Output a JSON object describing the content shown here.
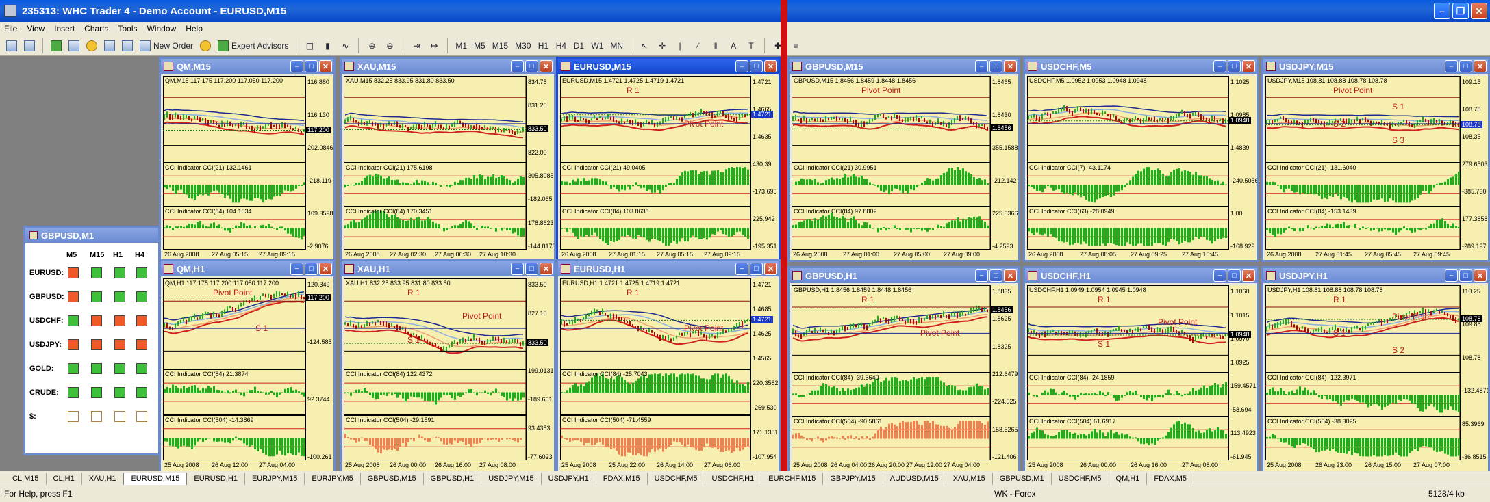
{
  "window": {
    "title": "235313: WHC Trader 4 - Demo Account - EURUSD,M15"
  },
  "menu": [
    "File",
    "View",
    "Insert",
    "Charts",
    "Tools",
    "Window",
    "Help"
  ],
  "toolbar": {
    "new_order": "New Order",
    "expert_advisors": "Expert Advisors",
    "periods": [
      "M1",
      "M5",
      "M15",
      "M30",
      "H1",
      "H4",
      "D1",
      "W1",
      "MN"
    ]
  },
  "panel": {
    "title": "GBPUSD,M1",
    "headers": [
      "M5",
      "M15",
      "H1",
      "H4"
    ],
    "rows": [
      {
        "label": "EURUSD:",
        "cells": [
          "r",
          "g",
          "g",
          "g"
        ]
      },
      {
        "label": "GBPUSD:",
        "cells": [
          "r",
          "g",
          "g",
          "g"
        ]
      },
      {
        "label": "USDCHF:",
        "cells": [
          "g",
          "r",
          "r",
          "r"
        ]
      },
      {
        "label": "USDJPY:",
        "cells": [
          "r",
          "r",
          "r",
          "r"
        ]
      },
      {
        "label": "GOLD:",
        "cells": [
          "g",
          "g",
          "g",
          "g"
        ]
      },
      {
        "label": "CRUDE:",
        "cells": [
          "g",
          "g",
          "g",
          "g"
        ]
      },
      {
        "label": "$:",
        "cells": [
          "w",
          "w",
          "w",
          "w"
        ]
      }
    ]
  },
  "charts": [
    {
      "title": "QM,M15",
      "header": "QM,M15  117.175 117.200 117.050 117.200",
      "ind1": "CCI Indicator  CCI(21) 132.1461",
      "ind2": "CCI Indicator  CCI(84) 104.1534",
      "prices": [
        "116.880",
        "116.130",
        "202.0846",
        "-218.119",
        "109.3598",
        "-2.9076"
      ],
      "price_tag": "117.200",
      "xlabels": [
        "26 Aug 2008",
        "27 Aug 05:15",
        "27 Aug 09:15"
      ],
      "annot": []
    },
    {
      "title": "XAU,M15",
      "header": "XAU,M15  832.25 833.95 831.80 833.50",
      "ind1": "CCI Indicator  CCI(21) 175.6198",
      "ind2": "CCI Indicator  CCI(84) 170.3451",
      "prices": [
        "834.75",
        "831.20",
        "828.15",
        "822.00",
        "305.8085",
        "-182.065",
        "178.8623",
        "-144.8173"
      ],
      "price_tag": "833.50",
      "xlabels": [
        "26 Aug 2008",
        "27 Aug 02:30",
        "27 Aug 06:30",
        "27 Aug 10:30"
      ],
      "annot": []
    },
    {
      "title": "EURUSD,M15",
      "header": "EURUSD,M15  1.4721 1.4725 1.4719 1.4721",
      "ind1": "CCI Indicator  CCI(21) 49.0405",
      "ind2": "CCI Indicator  CCI(84) 103.8638",
      "prices": [
        "1.4721",
        "1.4665",
        "1.4635",
        "430.39",
        "-173.695",
        "225.942",
        "-195.351"
      ],
      "price_tag": "1.4721",
      "xlabels": [
        "26 Aug 2008",
        "27 Aug 01:15",
        "27 Aug 05:15",
        "27 Aug 09:15"
      ],
      "annot": [
        "R 1",
        "Pivot Point"
      ]
    },
    {
      "title": "GBPUSD,M15",
      "header": "GBPUSD,M15  1.8456 1.8459 1.8448 1.8456",
      "ind1": "CCI Indicator  CCI(21) 30.9951",
      "ind2": "CCI Indicator  CCI(84) 97.8802",
      "prices": [
        "1.8465",
        "1.8430",
        "355.1588",
        "-212.142",
        "225.5366",
        "-4.2593"
      ],
      "price_tag": "1.8456",
      "xlabels": [
        "26 Aug 2008",
        "27 Aug 01:00",
        "27 Aug 05:00",
        "27 Aug 09:00"
      ],
      "annot": [
        "Pivot Point"
      ]
    },
    {
      "title": "USDCHF,M5",
      "header": "USDCHF,M5  1.0952 1.0953 1.0948 1.0948",
      "ind1": "CCI Indicator  CCI(7) -43.1174",
      "ind2": "CCI Indicator  CCI(63) -28.0949",
      "prices": [
        "1.1025",
        "1.0985",
        "1.4839",
        "-240.5056",
        "1.00",
        "-168.929"
      ],
      "price_tag": "1.0948",
      "xlabels": [
        "26 Aug 2008",
        "27 Aug 08:05",
        "27 Aug 09:25",
        "27 Aug 10:45"
      ],
      "annot": []
    },
    {
      "title": "USDJPY,M15",
      "header": "USDJPY,M15  108.81 108.88 108.78 108.78",
      "ind1": "CCI Indicator  CCI(21) -131.6040",
      "ind2": "CCI Indicator  CCI(84) -153.1439",
      "prices": [
        "109.15",
        "108.78",
        "108.35",
        "279.6503",
        "-385.730",
        "177.3858",
        "-289.197"
      ],
      "price_tag": "108.78",
      "xlabels": [
        "26 Aug 2008",
        "27 Aug 01:45",
        "27 Aug 05:45",
        "27 Aug 09:45"
      ],
      "annot": [
        "Pivot Point",
        "S 1",
        "S 2",
        "S 3"
      ]
    },
    {
      "title": "QM,H1",
      "header": "QM,H1  117.175 117.200 117.050 117.200",
      "ind1": "CCI Indicator  CCI(84) 21.3874",
      "ind2": "CCI Indicator  CCI(504) -14.3869",
      "prices": [
        "120.349",
        "-124.588",
        "92.3744",
        "-100.261"
      ],
      "price_tag": "117.200",
      "xlabels": [
        "25 Aug 2008",
        "26 Aug 12:00",
        "27 Aug 04:00"
      ],
      "annot": [
        "Pivot Point",
        "S 1"
      ]
    },
    {
      "title": "XAU,H1",
      "header": "XAU,H1  832.25 833.95 831.80 833.50",
      "ind1": "CCI Indicator  CCI(84) 122.4372",
      "ind2": "CCI Indicator  CCI(504) -29.1591",
      "prices": [
        "833.50",
        "827.10",
        "807.10",
        "199.0131",
        "-189.661",
        "93.4353",
        "-77.6023"
      ],
      "price_tag": "833.50",
      "xlabels": [
        "25 Aug 2008",
        "26 Aug 00:00",
        "26 Aug 16:00",
        "27 Aug 08:00"
      ],
      "annot": [
        "R 1",
        "Pivot Point",
        "S 1"
      ]
    },
    {
      "title": "EURUSD,H1",
      "header": "EURUSD,H1  1.4721 1.4725 1.4719 1.4721",
      "ind1": "CCI Indicator  CCI(84) -25.7043",
      "ind2": "CCI Indicator  CCI(504) -71.4559",
      "prices": [
        "1.4721",
        "1.4685",
        "1.4625",
        "1.4565",
        "220.3582",
        "-269.530",
        "171.1351",
        "-107.954"
      ],
      "price_tag": "1.4721",
      "xlabels": [
        "25 Aug 2008",
        "25 Aug 22:00",
        "26 Aug 14:00",
        "27 Aug 06:00"
      ],
      "annot": [
        "R 1",
        "Pivot Point"
      ]
    },
    {
      "title": "GBPUSD,H1",
      "header": "GBPUSD,H1  1.8456 1.8459 1.8448 1.8456",
      "ind1": "CCI Indicator  CCI(84) -39.5640",
      "ind2": "CCI Indicator  CCI(504) -90.5861",
      "prices": [
        "1.8835",
        "1.8625",
        "1.8325",
        "212.6479",
        "-224.025",
        "158.5265",
        "-121.406"
      ],
      "price_tag": "1.8456",
      "xlabels": [
        "25 Aug 2008",
        "26 Aug 04:00",
        "26 Aug 20:00",
        "27 Aug 12:00",
        "27 Aug 04:00"
      ],
      "annot": [
        "R 1",
        "Pivot Point"
      ]
    },
    {
      "title": "USDCHF,H1",
      "header": "USDCHF,H1  1.0949 1.0954 1.0945 1.0948",
      "ind1": "CCI Indicator  CCI(84) -24.1859",
      "ind2": "CCI Indicator  CCI(504) 61.6917",
      "prices": [
        "1.1060",
        "1.1015",
        "1.0970",
        "1.0925",
        "159.4571",
        "-58.694",
        "113.4923",
        "-61.945"
      ],
      "price_tag": "1.0948",
      "xlabels": [
        "25 Aug 2008",
        "26 Aug 00:00",
        "26 Aug 16:00",
        "27 Aug 08:00"
      ],
      "annot": [
        "R 1",
        "Pivot Point",
        "S 1"
      ]
    },
    {
      "title": "USDJPY,H1",
      "header": "USDJPY,H1  108.81 108.88 108.78 108.78",
      "ind1": "CCI Indicator  CCI(84) -122.3971",
      "ind2": "CCI Indicator  CCI(504) -38.3025",
      "prices": [
        "110.25",
        "109.85",
        "108.78",
        "-132.4871",
        "85.3969",
        "-36.8515"
      ],
      "price_tag": "108.78",
      "xlabels": [
        "25 Aug 2008",
        "26 Aug 23:00",
        "26 Aug 15:00",
        "27 Aug 07:00"
      ],
      "annot": [
        "R 1",
        "Pivot Point",
        "S 1",
        "S 2"
      ]
    }
  ],
  "tabs": [
    "CL,M15",
    "CL,H1",
    "XAU,H1",
    "EURUSD,M15",
    "EURUSD,H1",
    "EURJPY,M15",
    "EURJPY,M5",
    "GBPUSD,M15",
    "GBPUSD,H1",
    "USDJPY,M15",
    "USDJPY,H1",
    "FDAX,M15",
    "USDCHF,M5",
    "USDCHF,H1",
    "EURCHF,M15",
    "GBPJPY,M15",
    "AUDUSD,M15",
    "XAU,M15",
    "GBPUSD,M1",
    "USDCHF,M5",
    "QM,H1",
    "FDAX,M5"
  ],
  "active_tab": "EURUSD,M15",
  "status": {
    "help": "For Help, press F1",
    "profile": "WK - Forex",
    "traffic": "5128/4 kb"
  },
  "colors": {
    "chart_bg": "#f7efb0",
    "bull": "#1ab01a",
    "bear": "#c00000",
    "accent": "#1c4cd4"
  }
}
